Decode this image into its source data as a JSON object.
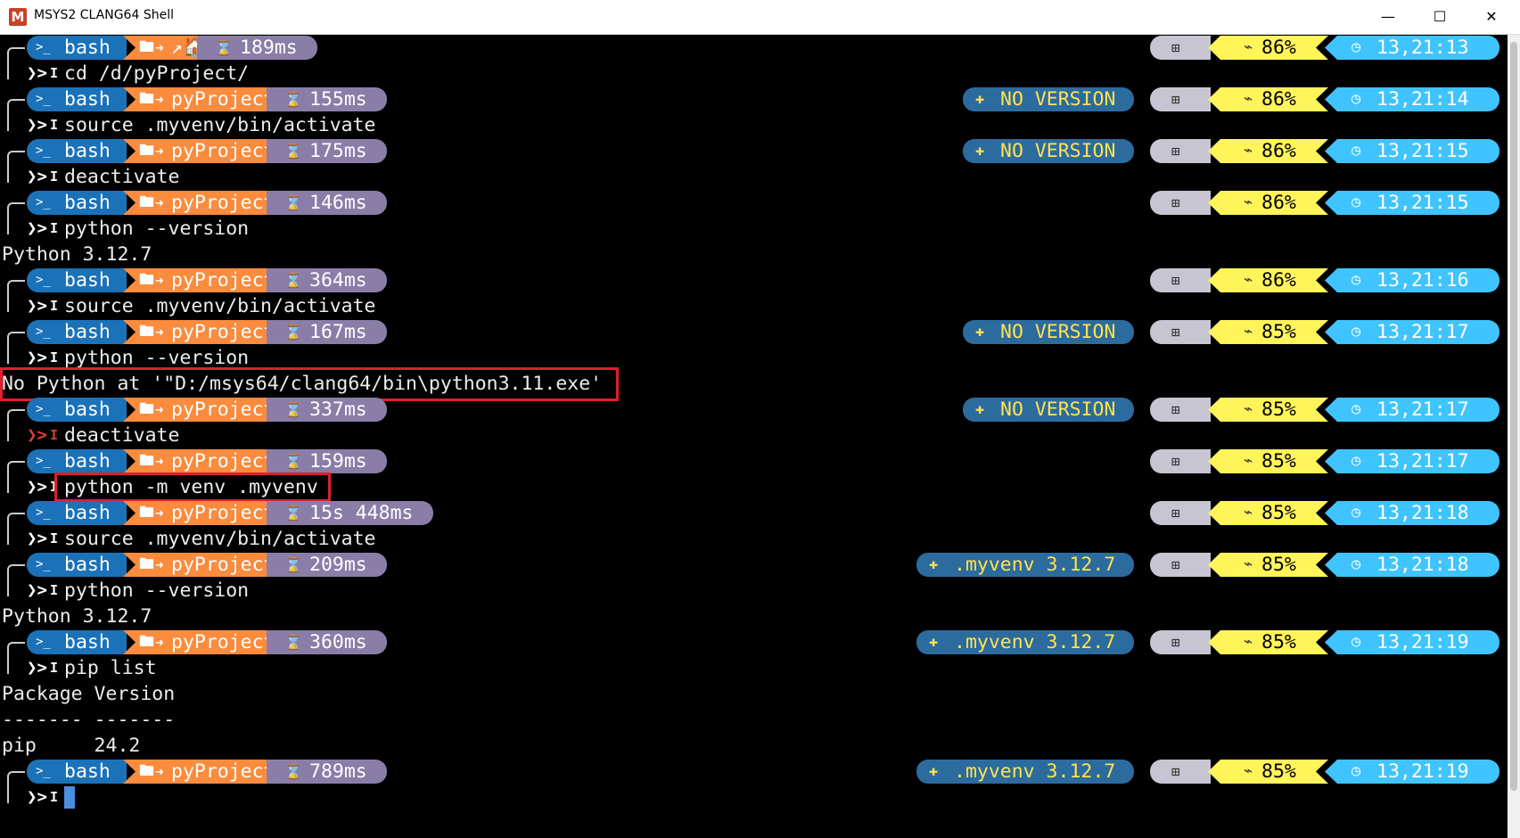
{
  "window": {
    "title": "MSYS2 CLANG64 Shell",
    "app_icon_letter": "M",
    "min_glyph": "—",
    "max_glyph": "☐",
    "close_glyph": "✕"
  },
  "glyphs": {
    "bash_icon": ">_",
    "folder_icon": "🖿",
    "hourglass_icon": "⌛",
    "python_icon": "✚",
    "windows_icon": "⊞",
    "battery_icon": "⌁",
    "clock_icon": "◷",
    "prompt_glyph": "❯>",
    "prompt_cursor": "I",
    "arrow_to": "➜"
  },
  "colors": {
    "bash": "#1b72b8",
    "path": "#fb8b3d",
    "exec_time": "#8a7ea8",
    "python": "#2c6b9e",
    "python_text": "#ffe34f",
    "os": "#c7c5d2",
    "battery": "#fff45a",
    "time": "#40c4ff",
    "highlight": "#e01e2d"
  },
  "prompts": [
    {
      "shell": "bash",
      "path": "↗🏠",
      "exec": "189ms",
      "python": "",
      "battery": "86%",
      "time": "13,21:13",
      "command": "cd /d/pyProject/"
    },
    {
      "shell": "bash",
      "path": "pyProject",
      "exec": "155ms",
      "python": "NO VERSION",
      "battery": "86%",
      "time": "13,21:14",
      "command": "source .myvenv/bin/activate"
    },
    {
      "shell": "bash",
      "path": "pyProject",
      "exec": "175ms",
      "python": "NO VERSION",
      "battery": "86%",
      "time": "13,21:15",
      "command": "deactivate"
    },
    {
      "shell": "bash",
      "path": "pyProject",
      "exec": "146ms",
      "python": "",
      "battery": "86%",
      "time": "13,21:15",
      "command": "python --version",
      "output": [
        "Python 3.12.7"
      ]
    },
    {
      "shell": "bash",
      "path": "pyProject",
      "exec": "364ms",
      "python": "",
      "battery": "86%",
      "time": "13,21:16",
      "command": "source .myvenv/bin/activate"
    },
    {
      "shell": "bash",
      "path": "pyProject",
      "exec": "167ms",
      "python": "NO VERSION",
      "battery": "85%",
      "time": "13,21:17",
      "command": "python --version",
      "output": [
        "No Python at '\"D:/msys64/clang64/bin\\python3.11.exe'"
      ]
    },
    {
      "shell": "bash",
      "path": "pyProject",
      "exec": "337ms",
      "python": "NO VERSION",
      "battery": "85%",
      "time": "13,21:17",
      "command": "deactivate",
      "error": true
    },
    {
      "shell": "bash",
      "path": "pyProject",
      "exec": "159ms",
      "python": "",
      "battery": "85%",
      "time": "13,21:17",
      "command": "python -m venv .myvenv"
    },
    {
      "shell": "bash",
      "path": "pyProject",
      "exec": "15s 448ms",
      "python": "",
      "battery": "85%",
      "time": "13,21:18",
      "command": "source .myvenv/bin/activate"
    },
    {
      "shell": "bash",
      "path": "pyProject",
      "exec": "209ms",
      "python": ".myvenv 3.12.7",
      "battery": "85%",
      "time": "13,21:18",
      "command": "python --version",
      "output": [
        "Python 3.12.7"
      ]
    },
    {
      "shell": "bash",
      "path": "pyProject",
      "exec": "360ms",
      "python": ".myvenv 3.12.7",
      "battery": "85%",
      "time": "13,21:19",
      "command": "pip list",
      "output": [
        "Package Version",
        "------- -------",
        "pip     24.2"
      ]
    },
    {
      "shell": "bash",
      "path": "pyProject",
      "exec": "789ms",
      "python": ".myvenv 3.12.7",
      "battery": "85%",
      "time": "13,21:19",
      "command": ""
    }
  ]
}
